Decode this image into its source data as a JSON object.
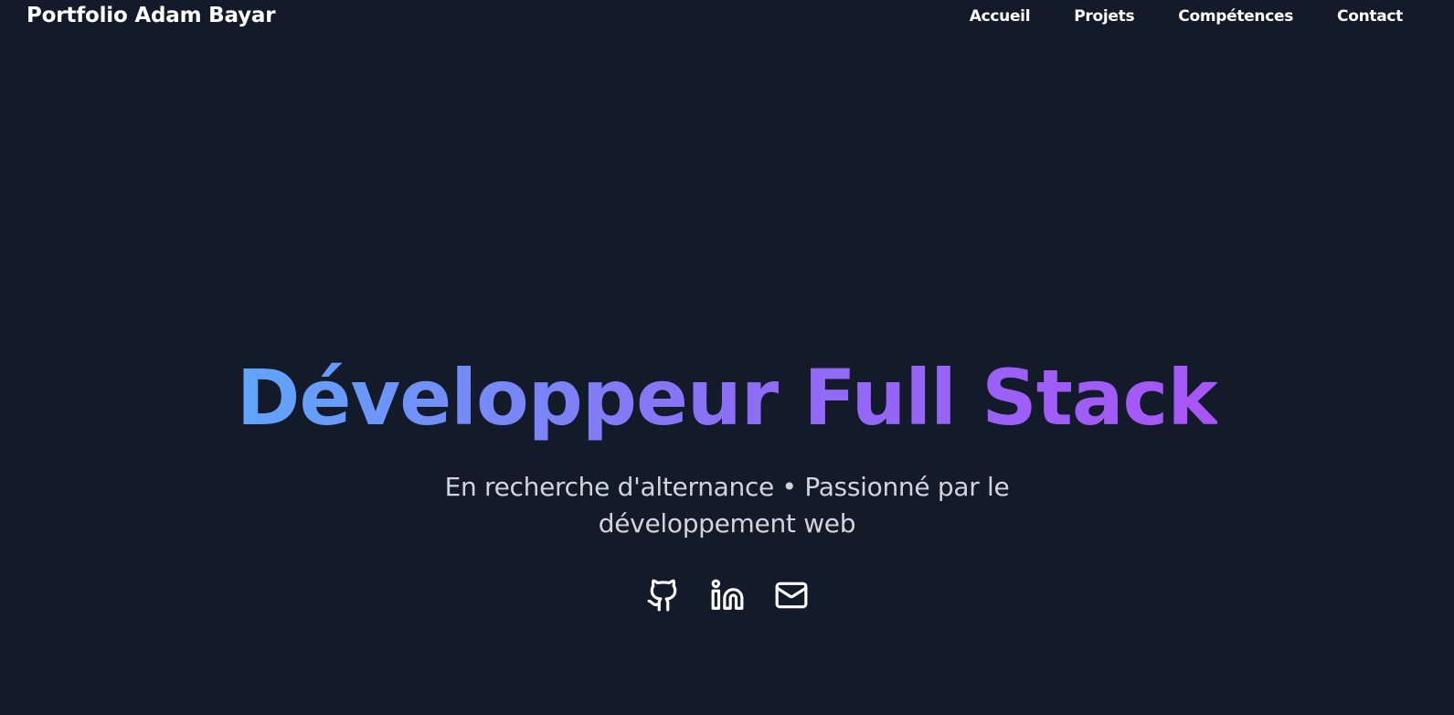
{
  "navbar": {
    "brand": "Portfolio Adam Bayar",
    "links": [
      {
        "label": "Accueil"
      },
      {
        "label": "Projets"
      },
      {
        "label": "Compétences"
      },
      {
        "label": "Contact"
      }
    ]
  },
  "hero": {
    "title": "Développeur Full Stack",
    "subtitle": "En recherche d'alternance • Passionné par le développement web"
  },
  "socials": [
    {
      "icon": "github-icon"
    },
    {
      "icon": "linkedin-icon"
    },
    {
      "icon": "mail-icon"
    }
  ],
  "colors": {
    "background": "#131a2a",
    "gradient_start": "#60a5fa",
    "gradient_mid": "#8b6ff6",
    "gradient_end": "#a855f7",
    "text_primary": "#ffffff",
    "text_secondary": "#d1d5db"
  }
}
